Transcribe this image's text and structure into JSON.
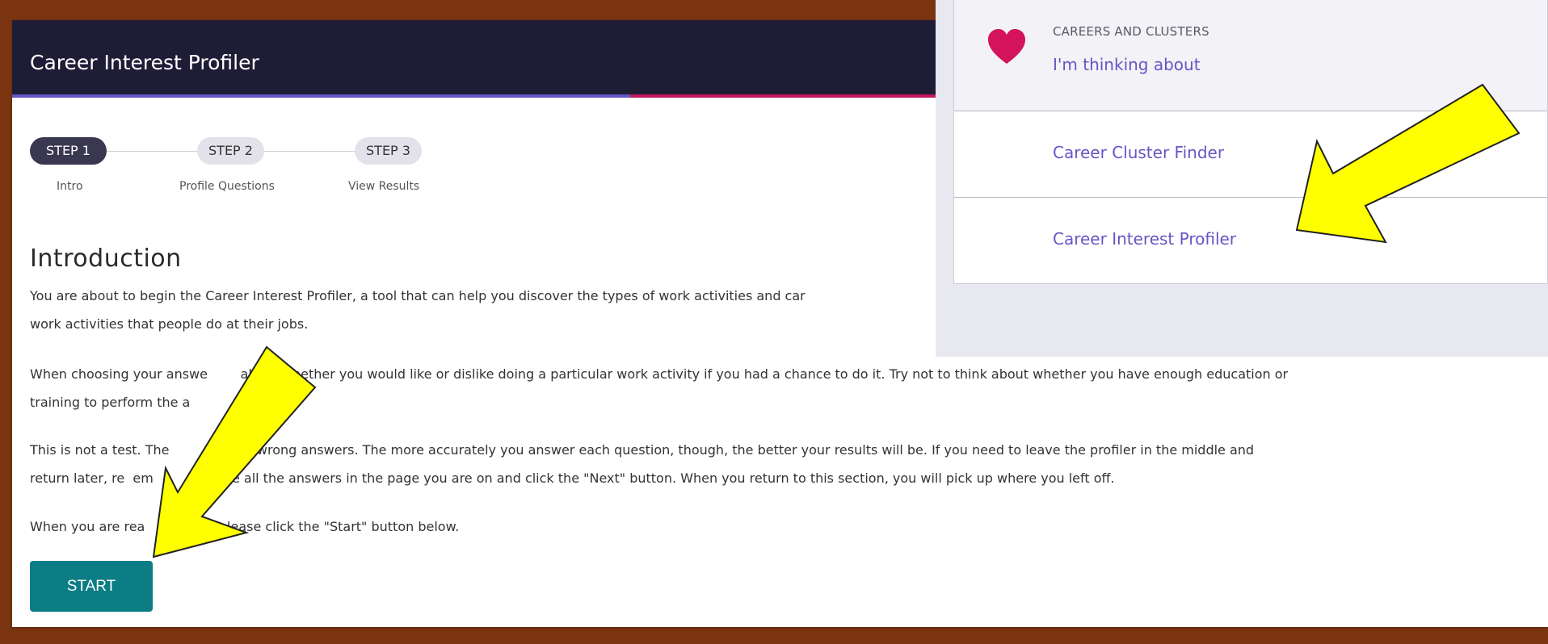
{
  "header": {
    "title": "Career Interest Profiler"
  },
  "colors": {
    "accent_purple": "#6654c6",
    "accent_pink": "#c4175e",
    "teal": "#0c7d84",
    "annotation_arrow": "#ffff00"
  },
  "steps": [
    {
      "label": "STEP 1",
      "sublabel": "Intro",
      "active": true
    },
    {
      "label": "STEP 2",
      "sublabel": "Profile Questions",
      "active": false
    },
    {
      "label": "STEP 3",
      "sublabel": "View Results",
      "active": false
    }
  ],
  "intro": {
    "title": "Introduction",
    "para1_line1": "You are about to begin the Career Interest Profiler, a tool that can help you discover the types of work activities and car",
    "para1_line2": "work activities that people do at their jobs.",
    "para2_line1": "When choosing your answe        about whether you would like or dislike doing a particular work activity if you had a chance to do it. Try not to think about whether you have enough education or",
    "para2_line2": "training to perform the a",
    "para3_line1": "This is not a test. The          ight or wrong answers. The more accurately you answer each question, though, the better your results will be. If you need to leave the profiler in the middle and",
    "para3_line2": "return later, re  em          mplete all the answers in the page you are on and click the \"Next\" button. When you return to this section, you will pick up where you left off.",
    "para4": "When you are rea                , please click the \"Start\" button below.",
    "start_label": "START"
  },
  "menu": {
    "overline": "CAREERS AND CLUSTERS",
    "thinking_label": "I'm thinking about",
    "items": [
      "Career Cluster Finder",
      "Career Interest Profiler"
    ],
    "heart_icon": "heart-icon"
  }
}
